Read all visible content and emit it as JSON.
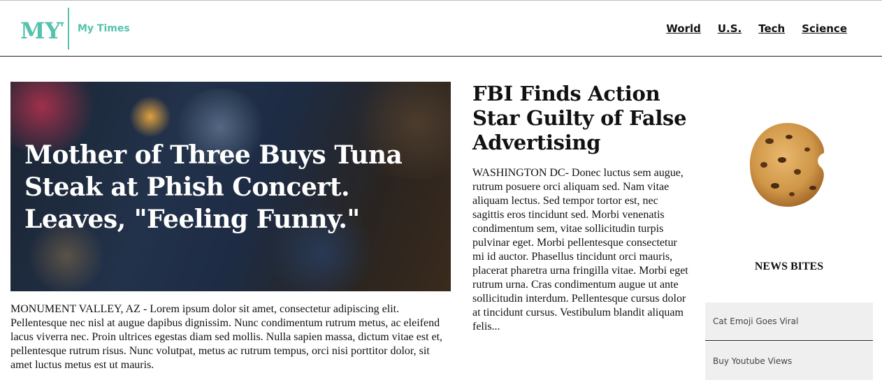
{
  "header": {
    "logo_text": "MYT",
    "brand_name": "My Times",
    "nav": [
      "World",
      "U.S.",
      "Tech",
      "Science"
    ]
  },
  "hero": {
    "title": "Mother of Three Buys Tuna Steak at Phish Concert. Leaves, \"Feeling Funny.\"",
    "body": "MONUMENT VALLEY, AZ - Lorem ipsum dolor sit amet, consectetur adipiscing elit. Pellentesque nec nisl at augue dapibus dignissim. Nunc condimentum rutrum metus, ac eleifend lacus viverra nec. Proin ultrices egestas diam sed mollis. Nulla sapien massa, dictum vitae est et, pellentesque rutrum risus. Nunc volutpat, metus ac rutrum tempus, orci nisi porttitor dolor, sit amet luctus metus est ut mauris."
  },
  "article2": {
    "title": "FBI Finds Action Star Guilty of False Advertising",
    "body": "WASHINGTON DC- Donec luctus sem augue, rutrum posuere orci aliquam sed. Nam vitae aliquam lectus. Sed tempor tortor est, nec sagittis eros tincidunt sed. Morbi venenatis condimentum sem, vitae sollicitudin turpis pulvinar eget. Morbi pellentesque consectetur mi id auctor. Phasellus tincidunt orci mauris, placerat pharetra urna fringilla vitae. Morbi eget rutrum urna. Cras condimentum augue ut ante sollicitudin interdum. Pellentesque cursus dolor at tincidunt cursus. Vestibulum blandit aliquam felis..."
  },
  "sidebar": {
    "heading": "NEWS BITES",
    "items": [
      "Cat Emoji Goes Viral",
      "Buy Youtube Views"
    ]
  },
  "colors": {
    "accent": "#55c2ad",
    "hero_bg": "#1d2c44",
    "bite_bg": "#efefef"
  },
  "icons": {
    "logo": "myt-logo",
    "sidebar_image": "cookie-image"
  }
}
